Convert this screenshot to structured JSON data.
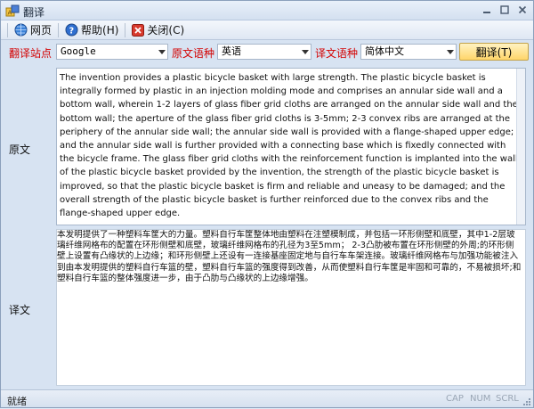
{
  "window": {
    "title": "翻译"
  },
  "toolbar": {
    "web_label": "网页",
    "help_label": "帮助(H)",
    "close_label": "关闭(C)"
  },
  "controls": {
    "site_label": "翻译站点",
    "site_value": "Google",
    "source_lang_label": "原文语种",
    "source_lang_value": "英语",
    "target_lang_label": "译文语种",
    "target_lang_value": "简体中文",
    "translate_button": "翻译(T)"
  },
  "source": {
    "label": "原文",
    "text": "The invention provides a plastic bicycle basket with large strength. The plastic bicycle basket is integrally formed by plastic in an injection molding mode and comprises an annular side wall and a bottom wall, wherein 1-2 layers of glass fiber grid cloths are arranged on the annular side wall and the bottom wall; the aperture of the glass fiber grid cloths is 3-5mm; 2-3 convex ribs are arranged at the periphery of the annular side wall; the annular side wall is provided with a flange-shaped upper edge; and the annular side wall is further provided with a connecting base which is fixedly connected with the bicycle frame. The glass fiber grid cloths with the reinforcement function is implanted into the wall of the plastic bicycle basket provided by the invention, the strength of the plastic bicycle basket is improved, so that the plastic bicycle basket is firm and reliable and uneasy to be damaged; and the overall strength of the plastic bicycle basket is further reinforced due to the convex ribs and the flange-shaped upper edge."
  },
  "target": {
    "label": "译文",
    "text": "本发明提供了一种塑料车筐大的力量。塑料自行车筐整体地由塑料在注塑模制成，并包括一环形侧壁和底壁，其中1-2层玻璃纤维网格布的配置在环形侧壁和底壁，玻璃纤维网格布的孔径为3至5mm； 2-3凸肋被布置在环形侧壁的外周;的环形侧壁上设置有凸缘状的上边缘；和环形侧壁上还设有一连接基座固定地与自行车车架连接。玻璃纤维网格布与加强功能被注入到由本发明提供的塑料自行车篮的壁，塑料自行车篮的强度得到改善，从而使塑料自行车筐是牢固和可靠的，不易被损坏;和塑料自行车篮的整体强度进一步，由于凸肋与凸缘状的上边缘增强。"
  },
  "status": {
    "text": "就绪",
    "cap": "CAP",
    "num": "NUM",
    "scrl": "SCRL"
  }
}
